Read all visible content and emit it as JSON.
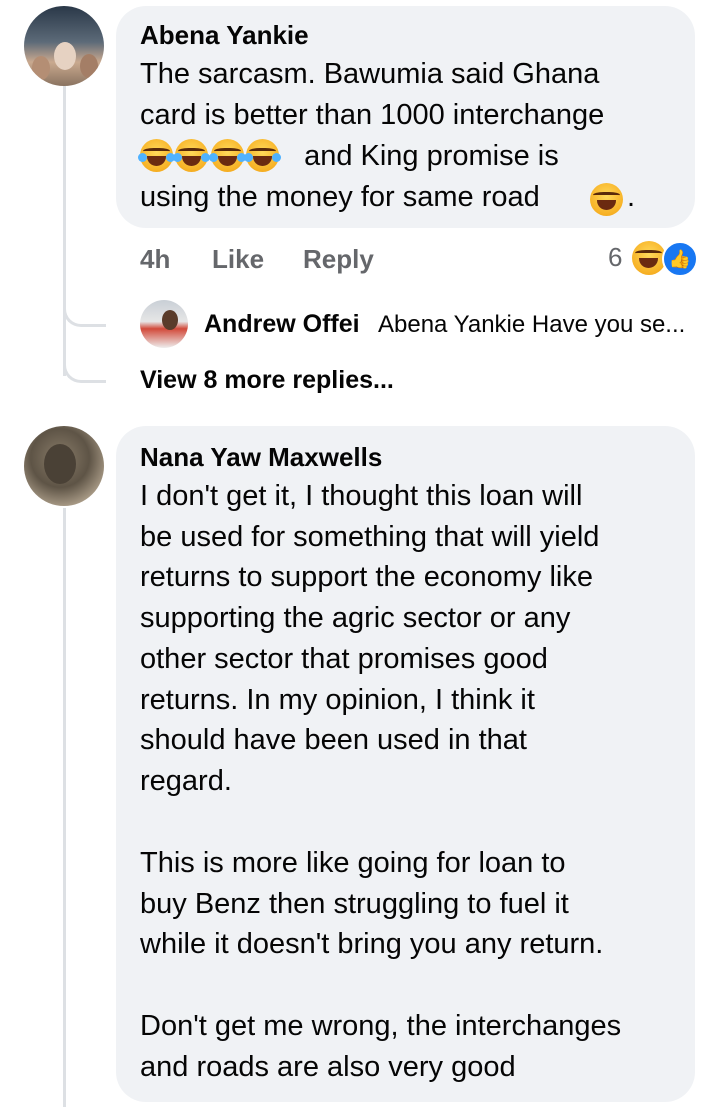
{
  "comment1": {
    "author": "Abena Yankie",
    "text_lines": [
      "The sarcasm. Bawumia said Ghana",
      "card is better than 1000 interchange",
      " and King promise is",
      "using the money for same road ",
      "."
    ],
    "time": "4h",
    "like_label": "Like",
    "reply_label": "Reply",
    "reaction_count": "6"
  },
  "reply1": {
    "author": "Andrew Offei",
    "text": "Abena Yankie Have you se..."
  },
  "view_more": "View 8 more replies...",
  "comment2": {
    "author": "Nana Yaw Maxwells",
    "paragraph1": "I don't get it, I thought this loan will\nbe used for something that will yield\nreturns to support the economy like\nsupporting the agric sector or any\nother sector that promises good\nreturns. In my opinion, I think it\nshould have been used in that\nregard.",
    "paragraph2": "This is more like going for loan to\nbuy Benz then struggling to fuel it\nwhile it doesn't bring you any return.",
    "paragraph3": "Don't get me wrong, the interchanges\nand roads are also very good"
  }
}
